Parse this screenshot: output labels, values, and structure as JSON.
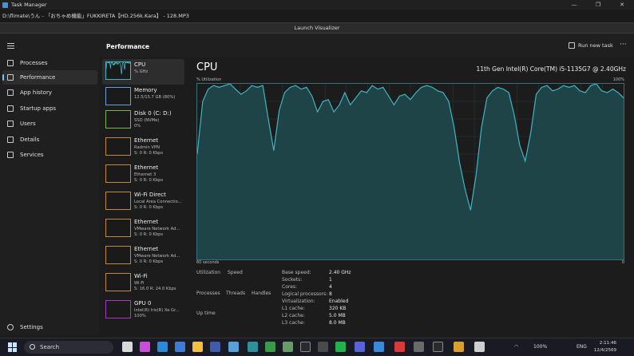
{
  "window": {
    "title": "Task Manager",
    "minimize": "—",
    "maximize": "❐",
    "close": "✕"
  },
  "media_path": "D:\\flimate\\うん - 「おちゃめ機能」FUKKIRETA【HD.256k.Kara】 - 128.MP3",
  "launch_visualizer": "Launch Visualizer",
  "nav": {
    "items": [
      {
        "label": "Processes"
      },
      {
        "label": "Performance"
      },
      {
        "label": "App history"
      },
      {
        "label": "Startup apps"
      },
      {
        "label": "Users"
      },
      {
        "label": "Details"
      },
      {
        "label": "Services"
      }
    ],
    "settings": "Settings"
  },
  "header": {
    "title": "Performance",
    "run_new_task": "Run new task",
    "more": "···"
  },
  "devices": [
    {
      "name": "CPU",
      "sub1": "%      GHz",
      "sub2": "",
      "color": "#3fb6c2"
    },
    {
      "name": "Memory",
      "sub1": "12.5/15.7 GB (80%)",
      "sub2": "",
      "color": "#6b9bd8"
    },
    {
      "name": "Disk 0 (C: D:)",
      "sub1": "SSD (NVMe)",
      "sub2": "0%",
      "color": "#7fb24a"
    },
    {
      "name": "Ethernet",
      "sub1": "Radmin VPN",
      "sub2": "S: 0 R: 0 Kbps",
      "color": "#c08a3a"
    },
    {
      "name": "Ethernet",
      "sub1": "Ethernet 3",
      "sub2": "S: 0 R: 0 Kbps",
      "color": "#c08a3a"
    },
    {
      "name": "Wi-Fi Direct",
      "sub1": "Local Area Connectio...",
      "sub2": "S: 0 R: 0 Kbps",
      "color": "#c08a3a"
    },
    {
      "name": "Ethernet",
      "sub1": "VMware Network Ad...",
      "sub2": "S: 0 R: 0 Kbps",
      "color": "#c08a3a"
    },
    {
      "name": "Ethernet",
      "sub1": "VMware Network Ad...",
      "sub2": "S: 0 R: 0 Kbps",
      "color": "#c08a3a"
    },
    {
      "name": "Wi-Fi",
      "sub1": "Wi-Fi",
      "sub2": "S: 16.0 R: 24.0 Kbps",
      "color": "#c08a3a"
    },
    {
      "name": "GPU 0",
      "sub1": "Intel(R) Iris(R) Xe Gr...",
      "sub2": "100%",
      "color": "#a13bbf"
    }
  ],
  "cpu": {
    "title": "CPU",
    "model": "11th Gen Intel(R) Core(TM) i5-1135G7 @ 2.40GHz",
    "util_label": "% Utilization",
    "util_max": "100%",
    "time_left": "60 seconds",
    "time_right": "0",
    "graph_color": "#3fb6c2",
    "graph_fill": "#1f4447",
    "utilization_series": [
      60,
      90,
      97,
      99,
      98,
      99,
      100,
      97,
      94,
      96,
      99,
      98,
      99,
      80,
      62,
      85,
      95,
      98,
      99,
      97,
      98,
      93,
      84,
      90,
      91,
      84,
      88,
      95,
      88,
      92,
      96,
      95,
      99,
      97,
      98,
      93,
      88,
      93,
      94,
      91,
      95,
      98,
      99,
      98,
      96,
      95,
      90,
      75,
      55,
      40,
      28,
      48,
      75,
      92,
      96,
      98,
      97,
      95,
      82,
      65,
      56,
      72,
      94,
      98,
      99,
      96,
      97,
      99,
      98,
      99,
      96,
      95,
      99,
      100,
      96,
      95,
      97,
      95,
      92
    ],
    "stats": {
      "utilization": "Utilization",
      "speed": "Speed",
      "processes": "Processes",
      "threads": "Threads",
      "handles": "Handles",
      "uptime": "Up time"
    },
    "specs": [
      {
        "label": "Base speed:",
        "value": "2.40 GHz"
      },
      {
        "label": "Sockets:",
        "value": "1"
      },
      {
        "label": "Cores:",
        "value": "4"
      },
      {
        "label": "Logical processors:",
        "value": "8"
      },
      {
        "label": "Virtualization:",
        "value": "Enabled"
      },
      {
        "label": "L1 cache:",
        "value": "320 KB"
      },
      {
        "label": "L2 cache:",
        "value": "5.0 MB"
      },
      {
        "label": "L3 cache:",
        "value": "8.0 MB"
      }
    ]
  },
  "taskbar": {
    "search": "Search",
    "battery": "100%",
    "lang": "ENG",
    "time": "2:11:46",
    "date": "12/4/2569"
  }
}
